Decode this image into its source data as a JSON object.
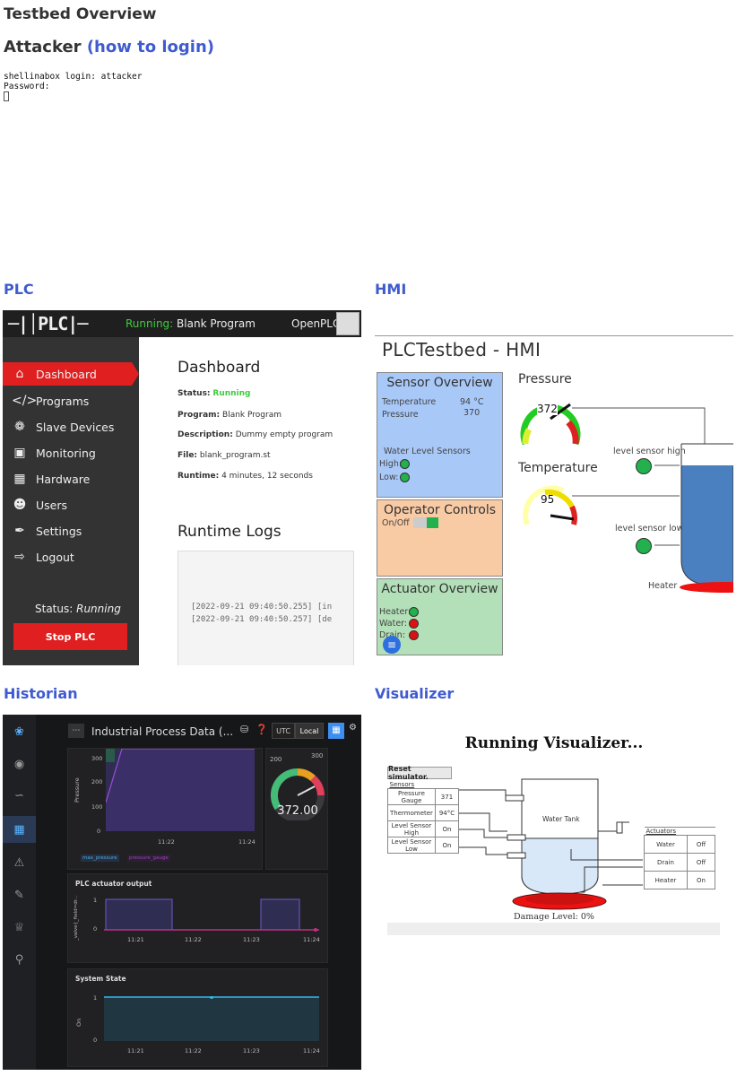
{
  "page": {
    "title": "Testbed Overview"
  },
  "attacker": {
    "title": "Attacker",
    "link": "(how to login)",
    "terminal": "shellinabox login: attacker\nPassword:"
  },
  "sections": {
    "plc": "PLC",
    "hmi": "HMI",
    "historian": "Historian",
    "visualizer": "Visualizer"
  },
  "plc": {
    "logo": "─|│PLC|─",
    "running_label": "Running:",
    "program_name": "Blank Program",
    "brand": "OpenPLC",
    "nav": [
      {
        "label": "Dashboard",
        "icon": "home-icon"
      },
      {
        "label": "Programs",
        "icon": "code-icon"
      },
      {
        "label": "Slave Devices",
        "icon": "gear-cluster-icon"
      },
      {
        "label": "Monitoring",
        "icon": "monitor-icon"
      },
      {
        "label": "Hardware",
        "icon": "chip-icon"
      },
      {
        "label": "Users",
        "icon": "users-icon"
      },
      {
        "label": "Settings",
        "icon": "wrench-icon"
      },
      {
        "label": "Logout",
        "icon": "logout-icon"
      }
    ],
    "status_label": "Status:",
    "status_value": "Running",
    "stop_button": "Stop PLC",
    "dashboard_title": "Dashboard",
    "status_key": "Status:",
    "status_val": "Running",
    "program_key": "Program:",
    "program_val": "Blank Program",
    "description_key": "Description:",
    "description_val": "Dummy empty program",
    "file_key": "File:",
    "file_val": "blank_program.st",
    "runtime_key": "Runtime:",
    "runtime_val": "4 minutes, 12 seconds",
    "logs_title": "Runtime Logs",
    "logs": [
      "[2022-09-21 09:40:50.255] [in",
      "[2022-09-21 09:40:50.257] [de"
    ]
  },
  "hmi": {
    "title": "PLCTestbed - HMI",
    "sensor_overview": "Sensor Overview",
    "temperature_label": "Temperature",
    "temperature_value": "94 °C",
    "pressure_label": "Pressure",
    "pressure_value": "370",
    "water_level_label": "Water Level Sensors",
    "high_label": "High:",
    "low_label": "Low:",
    "operator_controls": "Operator Controls",
    "onoff_label": "On/Off",
    "actuator_overview": "Actuator Overview",
    "heater_label": "Heater:",
    "water_label": "Water:",
    "drain_label": "Drain:",
    "pressure_gauge_title": "Pressure",
    "pressure_gauge_value": "372",
    "temperature_gauge_title": "Temperature",
    "temperature_gauge_value": "95",
    "level_high_label": "level sensor high",
    "level_low_label": "level sensor low",
    "heater_tank_label": "Heater",
    "colors": {
      "sensor_bg": "#a8c8f8",
      "operator_bg": "#f9cba5",
      "actuator_bg": "#b3e0b8",
      "green": "#22b14c",
      "red": "#dd1111",
      "tank": "#4a7fc0"
    }
  },
  "historian": {
    "title": "Industrial Process Data (...",
    "utc": "UTC",
    "local": "Local",
    "pressure_axis": "Pressure",
    "pressure_ticks": [
      "300",
      "200",
      "100",
      "0"
    ],
    "pressure_times": [
      "11:22",
      "11:24"
    ],
    "legend": [
      "max_pressure",
      "pressure_gauge"
    ],
    "gauge_value": "372.00",
    "gauge_ticks": [
      "200",
      "300"
    ],
    "actuator_title": "PLC actuator output",
    "actuator_axis": "_valve{_field=dr...",
    "actuator_ticks": [
      "1",
      "0"
    ],
    "actuator_times": [
      "11:21",
      "11:22",
      "11:23",
      "11:24"
    ],
    "state_title": "System State",
    "state_axis": "On",
    "state_ticks": [
      "1",
      "0"
    ],
    "state_times": [
      "11:21",
      "11:22",
      "11:23",
      "11:24"
    ]
  },
  "visualizer": {
    "title": "Running Visualizer...",
    "reset": "Reset simulator.",
    "sensors_header": "Sensors",
    "sensors": [
      {
        "name": "Pressure Gauge",
        "value": "371"
      },
      {
        "name": "Thermometer",
        "value": "94°C"
      },
      {
        "name": "Level Sensor High",
        "value": "On"
      },
      {
        "name": "Level Sensor Low",
        "value": "On"
      }
    ],
    "tank_label": "Water Tank",
    "actuators_header": "Actuators",
    "actuators": [
      {
        "name": "Water",
        "value": "Off"
      },
      {
        "name": "Drain",
        "value": "Off"
      },
      {
        "name": "Heater",
        "value": "On"
      }
    ],
    "damage": "Damage Level: 0%"
  }
}
